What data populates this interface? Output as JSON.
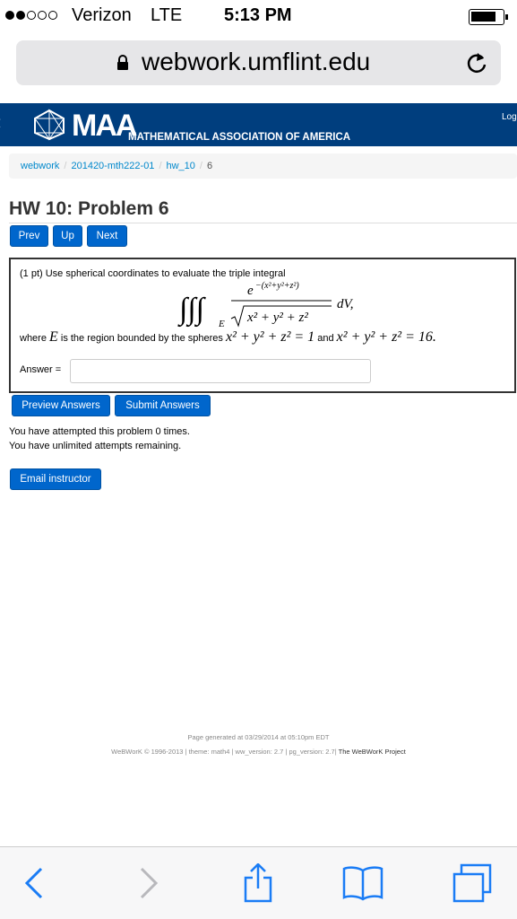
{
  "status_bar": {
    "carrier": "Verizon",
    "network": "LTE",
    "time": "5:13 PM"
  },
  "browser": {
    "url": "webwork.umflint.edu"
  },
  "maa": {
    "logo_text": "MAA",
    "subtitle": "MATHEMATICAL ASSOCIATION OF AMERICA",
    "login": "Log"
  },
  "breadcrumb": {
    "items": [
      "webwork",
      "201420-mth222-01",
      "hw_10"
    ],
    "current": "6"
  },
  "page": {
    "title": "HW 10: Problem 6"
  },
  "nav": {
    "prev": "Prev",
    "up": "Up",
    "next": "Next"
  },
  "problem": {
    "intro": "(1 pt) Use spherical coordinates to evaluate the triple integral",
    "where_label": "where",
    "region_var": "E",
    "region_text": "is the region bounded by the spheres",
    "sphere1": "x² + y² + z² = 1",
    "and_label": "and",
    "sphere2": "x² + y² + z² = 16.",
    "answer_label": "Answer =",
    "answer_value": ""
  },
  "actions": {
    "preview": "Preview Answers",
    "submit": "Submit Answers",
    "email": "Email instructor"
  },
  "attempts": {
    "line1": "You have attempted this problem 0 times.",
    "line2": "You have unlimited attempts remaining."
  },
  "footer": {
    "generated": "Page generated at 03/29/2014 at 05:10pm EDT",
    "version": "WeBWorK © 1996-2013 | theme: math4 | ww_version: 2.7 | pg_version: 2.7|",
    "project": "The WeBWorK Project"
  },
  "colors": {
    "maa_blue": "#003e7e",
    "button_blue": "#0066cc",
    "link_blue": "#0088cc",
    "ios_blue": "#1a7cf5"
  }
}
